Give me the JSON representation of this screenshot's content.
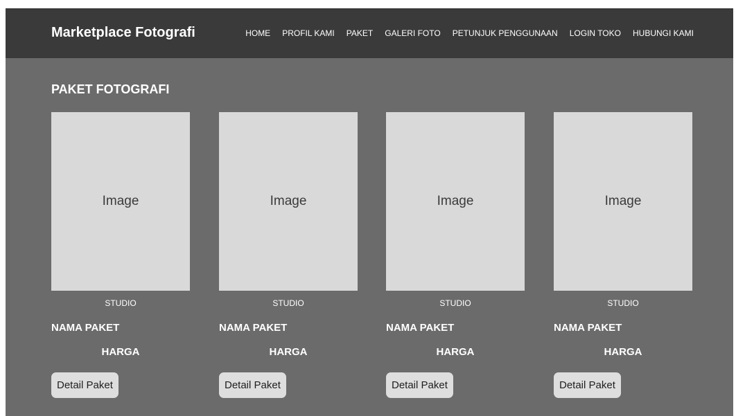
{
  "header": {
    "brand": "Marketplace Fotografi",
    "nav": [
      "HOME",
      "PROFIL KAMI",
      "PAKET",
      "GALERI FOTO",
      "PETUNJUK PENGGUNAAN",
      "LOGIN TOKO",
      "HUBUNGI KAMI"
    ]
  },
  "section": {
    "title": "PAKET FOTOGRAFI"
  },
  "cards": [
    {
      "image_label": "Image",
      "category": "STUDIO",
      "name": "NAMA PAKET",
      "price": "HARGA",
      "button_label": "Detail Paket"
    },
    {
      "image_label": "Image",
      "category": "STUDIO",
      "name": "NAMA PAKET",
      "price": "HARGA",
      "button_label": "Detail Paket"
    },
    {
      "image_label": "Image",
      "category": "STUDIO",
      "name": "NAMA PAKET",
      "price": "HARGA",
      "button_label": "Detail Paket"
    },
    {
      "image_label": "Image",
      "category": "STUDIO",
      "name": "NAMA PAKET",
      "price": "HARGA",
      "button_label": "Detail Paket"
    }
  ]
}
